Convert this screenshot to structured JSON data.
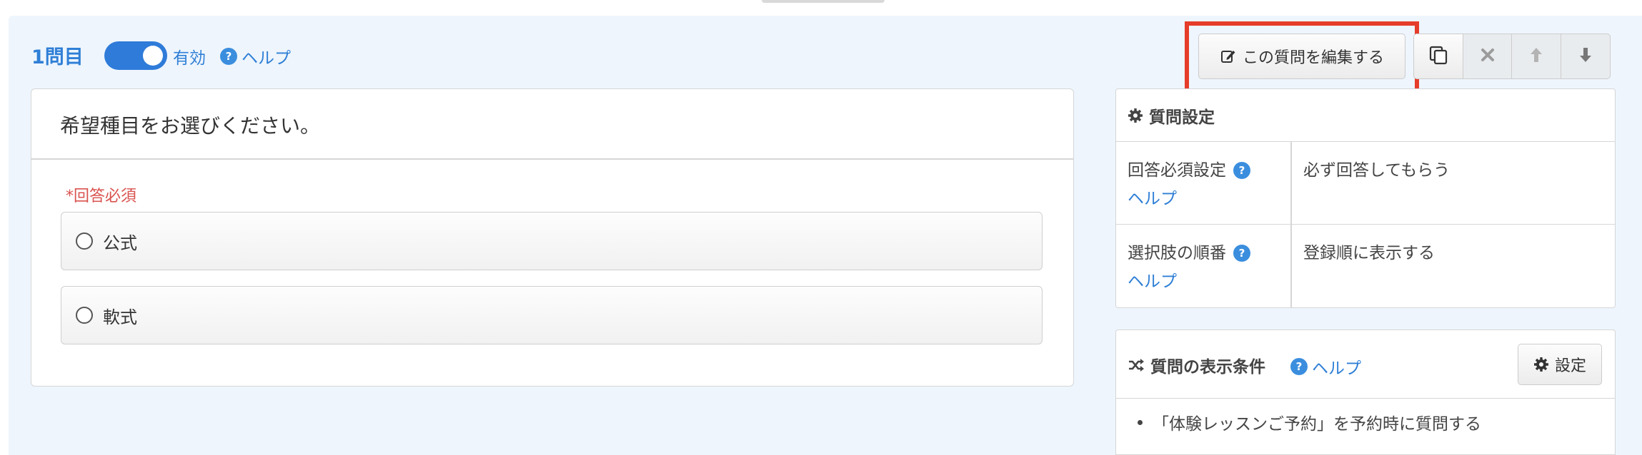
{
  "question": {
    "number_label": "1問目",
    "status_label": "有効",
    "help_label": "ヘルプ",
    "title": "希望種目をお選びください。",
    "required_label": "*回答必須",
    "choices": [
      {
        "label": "公式"
      },
      {
        "label": "軟式"
      }
    ]
  },
  "toolbar": {
    "edit_label": "この質問を編集する"
  },
  "settings": {
    "heading": "質問設定",
    "rows": [
      {
        "label": "回答必須設定",
        "help": "ヘルプ",
        "value": "必ず回答してもらう"
      },
      {
        "label": "選択肢の順番",
        "help": "ヘルプ",
        "value": "登録順に表示する"
      }
    ]
  },
  "display_condition": {
    "heading": "質問の表示条件",
    "help_label": "ヘルプ",
    "button_label": "設定",
    "items": [
      "「体験レッスンご予約」を予約時に質問する"
    ]
  },
  "icons": {
    "help": "question-circle-icon",
    "edit": "edit-icon",
    "copy": "copy-icon",
    "delete": "close-icon",
    "up": "arrow-up-icon",
    "down": "arrow-down-icon",
    "settings": "gear-icon",
    "condition": "shuffle-icon"
  },
  "colors": {
    "accent": "#2f7fd6",
    "toggle": "#2e7bd9",
    "required": "#d9534f",
    "highlight": "#e53d2a",
    "panel_bg": "#eef5fd"
  }
}
